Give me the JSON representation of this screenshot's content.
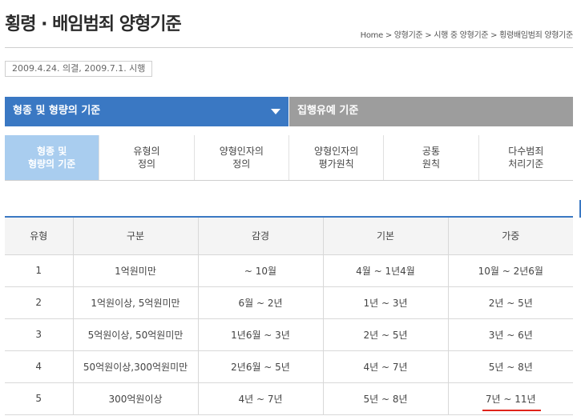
{
  "header": {
    "title": "횡령 · 배임범죄 양형기준",
    "breadcrumb": "Home > 양형기준 > 시행 중 양형기준 > 횡령배임범죄 양형기준"
  },
  "date_note": "2009.4.24. 의결, 2009.7.1. 시행",
  "main_tabs": [
    {
      "label": "형종 및 형량의 기준"
    },
    {
      "label": "집행유예 기준"
    }
  ],
  "sub_tabs": [
    {
      "line1": "형종 및",
      "line2": "형량의 기준"
    },
    {
      "line1": "유형의",
      "line2": "정의"
    },
    {
      "line1": "양형인자의",
      "line2": "정의"
    },
    {
      "line1": "양형인자의",
      "line2": "평가원칙"
    },
    {
      "line1": "공통",
      "line2": "원칙"
    },
    {
      "line1": "다수범죄",
      "line2": "처리기준"
    }
  ],
  "table": {
    "headers": [
      "유형",
      "구분",
      "감경",
      "기본",
      "가중"
    ],
    "rows": [
      [
        "1",
        "1억원미만",
        "~ 10월",
        "4월 ~ 1년4월",
        "10월 ~ 2년6월"
      ],
      [
        "2",
        "1억원이상, 5억원미만",
        "6월 ~ 2년",
        "1년 ~ 3년",
        "2년 ~ 5년"
      ],
      [
        "3",
        "5억원이상, 50억원미만",
        "1년6월 ~ 3년",
        "2년 ~ 5년",
        "3년 ~ 6년"
      ],
      [
        "4",
        "50억원이상,300억원미만",
        "2년6월 ~ 5년",
        "4년 ~ 7년",
        "5년 ~ 8년"
      ],
      [
        "5",
        "300억원이상",
        "4년 ~ 7년",
        "5년 ~ 8년",
        "7년 ~ 11년"
      ]
    ]
  },
  "colors": {
    "accent": "#3a78c3",
    "inactive_tab": "#9d9d9d",
    "active_subtab": "#a9cdef",
    "highlight": "#e0231a"
  }
}
